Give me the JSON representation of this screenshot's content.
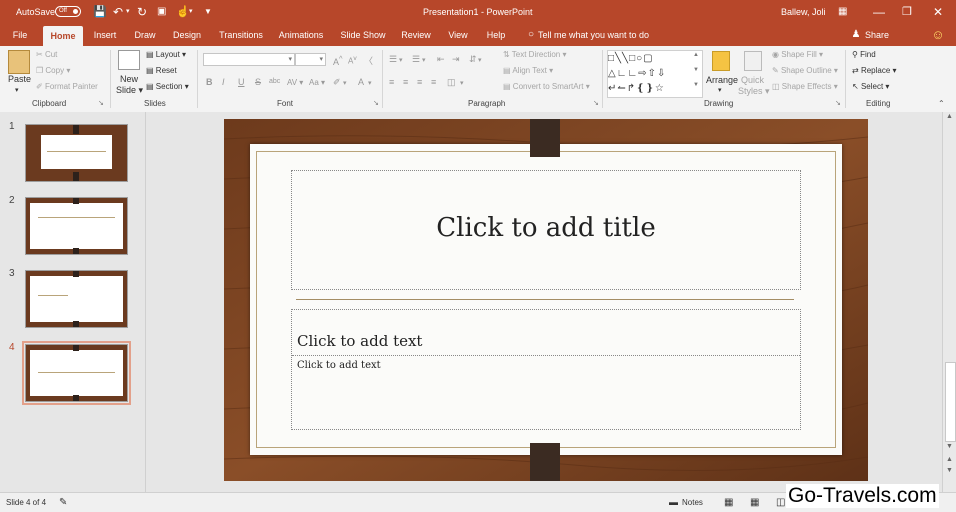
{
  "titlebar": {
    "autosave_label": "AutoSave",
    "autosave_state": "Off",
    "title": "Presentation1  -  PowerPoint",
    "user": "Ballew, Joli",
    "accent": "#b7472a"
  },
  "tabs": [
    {
      "label": "File"
    },
    {
      "label": "Home"
    },
    {
      "label": "Insert"
    },
    {
      "label": "Draw"
    },
    {
      "label": "Design"
    },
    {
      "label": "Transitions"
    },
    {
      "label": "Animations"
    },
    {
      "label": "Slide Show"
    },
    {
      "label": "Review"
    },
    {
      "label": "View"
    },
    {
      "label": "Help"
    }
  ],
  "tell_me": "Tell me what you want to do",
  "share_label": "Share",
  "ribbon": {
    "clipboard": {
      "paste": "Paste",
      "cut": "Cut",
      "copy": "Copy",
      "format_painter": "Format Painter",
      "label": "Clipboard"
    },
    "slides": {
      "new_slide_line1": "New",
      "new_slide_line2": "Slide",
      "layout": "Layout",
      "reset": "Reset",
      "section": "Section",
      "label": "Slides"
    },
    "font": {
      "label": "Font",
      "bold": "B",
      "italic": "I",
      "underline": "U",
      "strike": "S",
      "shadow": "abc",
      "spacing": "AV",
      "case": "Aa",
      "grow": "A",
      "shrink": "A"
    },
    "paragraph": {
      "label": "Paragraph",
      "text_direction": "Text Direction",
      "align_text": "Align Text",
      "smartart": "Convert to SmartArt"
    },
    "drawing": {
      "label": "Drawing",
      "arrange": "Arrange",
      "quick_styles_line1": "Quick",
      "quick_styles_line2": "Styles",
      "shape_fill": "Shape Fill",
      "shape_outline": "Shape Outline",
      "shape_effects": "Shape Effects"
    },
    "editing": {
      "label": "Editing",
      "find": "Find",
      "replace": "Replace",
      "select": "Select"
    }
  },
  "thumbnails": [
    {
      "number": "1"
    },
    {
      "number": "2"
    },
    {
      "number": "3"
    },
    {
      "number": "4"
    }
  ],
  "slide": {
    "title_placeholder": "Click to add title",
    "subtitle_placeholder": "Click to add text",
    "body_placeholder": "Click to add text"
  },
  "status": {
    "slide_info": "Slide 4 of 4",
    "notes": "Notes"
  },
  "watermark": "Go-Travels.com"
}
